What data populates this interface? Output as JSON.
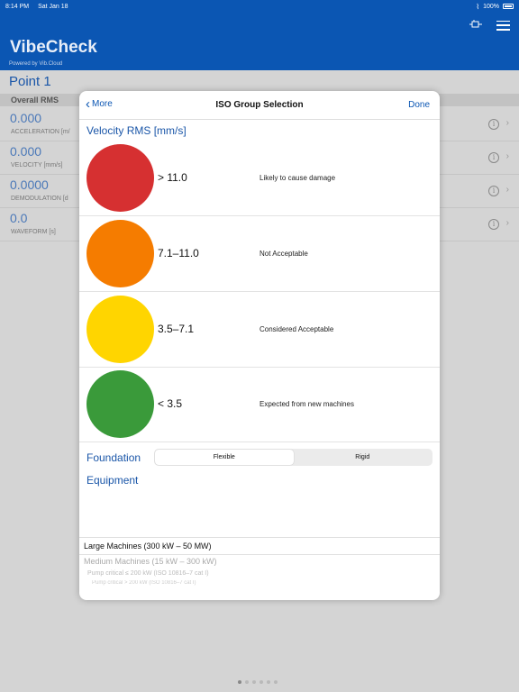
{
  "status": {
    "time": "8:14 PM",
    "date": "Sat Jan 18",
    "battery": "100%"
  },
  "app": {
    "title": "VibeCheck",
    "subtitle": "Powered by Vib.Cloud"
  },
  "page": {
    "title": "Point 1",
    "section": "Overall RMS",
    "measurements": [
      {
        "value": "0.000",
        "label": "ACCELERATION [m/"
      },
      {
        "value": "0.000",
        "label": "VELOCITY [mm/s]"
      },
      {
        "value": "0.0000",
        "label": "DEMODULATION [d"
      },
      {
        "value": "0.0",
        "label": "WAVEFORM [s]"
      }
    ]
  },
  "modal": {
    "back_label": "More",
    "title": "ISO Group Selection",
    "done_label": "Done",
    "velocity_label": "Velocity RMS [mm/s]",
    "zones": [
      {
        "range": "> 11.0",
        "description": "Likely to cause damage",
        "color": "#d63031"
      },
      {
        "range": "7.1–11.0",
        "description": "Not Acceptable",
        "color": "#f57c00"
      },
      {
        "range": "3.5–7.1",
        "description": "Considered Acceptable",
        "color": "#ffd500"
      },
      {
        "range": "< 3.5",
        "description": "Expected from new machines",
        "color": "#3a9a3a"
      }
    ],
    "foundation_label": "Foundation",
    "foundation_options": [
      "Flexible",
      "Rigid"
    ],
    "foundation_selected": "Flexible",
    "equipment_label": "Equipment",
    "equipment_options": [
      "Large Machines (300 kW – 50 MW)",
      "Medium Machines (15 kW – 300 kW)",
      "Pump critical ≤ 200 kW (ISO 10816–7 cat I)",
      "Pump critical > 200 kW (ISO 10816–7 cat I)"
    ]
  },
  "colors": {
    "brand": "#0b56b3",
    "accent_text": "#1a56a8"
  }
}
